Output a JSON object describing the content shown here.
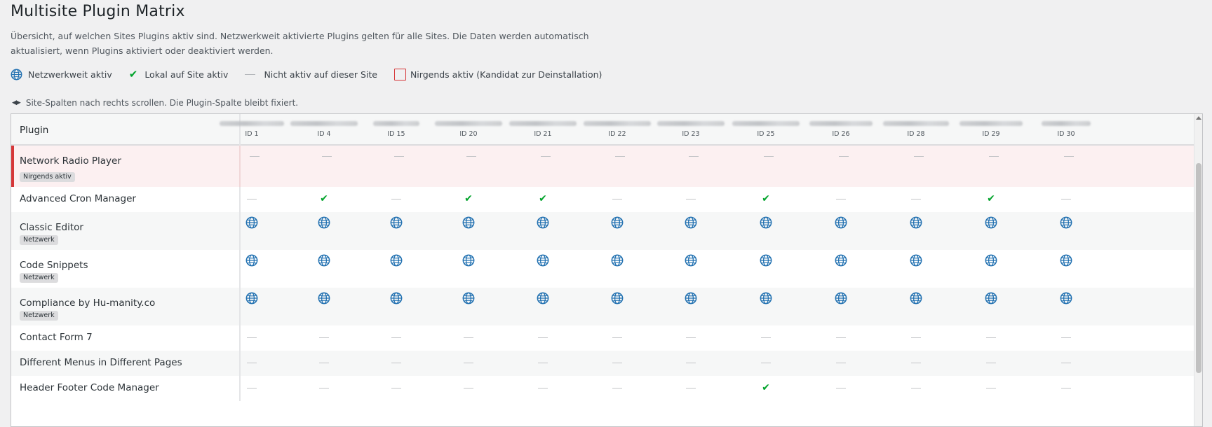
{
  "page": {
    "title": "Multisite Plugin Matrix",
    "description": "Übersicht, auf welchen Sites Plugins aktiv sind. Netzwerkweit aktivierte Plugins gelten für alle Sites. Die Daten werden automatisch aktualisiert, wenn Plugins aktiviert oder deaktiviert werden."
  },
  "legend": {
    "network": "Netzwerkweit aktiv",
    "local": "Lokal auf Site aktiv",
    "inactive": "Nicht aktiv auf dieser Site",
    "nowhere": "Nirgends aktiv (Kandidat zur Deinstallation)"
  },
  "scroll_hint": "Site-Spalten nach rechts scrollen. Die Plugin-Spalte bleibt fixiert.",
  "table": {
    "plugin_header": "Plugin",
    "sites": [
      "ID 1",
      "ID 4",
      "ID 15",
      "ID 20",
      "ID 21",
      "ID 22",
      "ID 23",
      "ID 25",
      "ID 26",
      "ID 28",
      "ID 29",
      "ID 30"
    ],
    "rows": [
      {
        "name": "Network Radio Player",
        "badge": "Nirgends aktiv",
        "variant": "danger",
        "cells": [
          "none",
          "none",
          "none",
          "none",
          "none",
          "none",
          "none",
          "none",
          "none",
          "none",
          "none",
          "none"
        ]
      },
      {
        "name": "Advanced Cron Manager",
        "badge": "",
        "variant": "white",
        "cells": [
          "none",
          "local",
          "none",
          "local",
          "local",
          "none",
          "none",
          "local",
          "none",
          "none",
          "local",
          "none"
        ]
      },
      {
        "name": "Classic Editor",
        "badge": "Netzwerk",
        "variant": "alt",
        "cells": [
          "network",
          "network",
          "network",
          "network",
          "network",
          "network",
          "network",
          "network",
          "network",
          "network",
          "network",
          "network"
        ]
      },
      {
        "name": "Code Snippets",
        "badge": "Netzwerk",
        "variant": "white",
        "cells": [
          "network",
          "network",
          "network",
          "network",
          "network",
          "network",
          "network",
          "network",
          "network",
          "network",
          "network",
          "network"
        ]
      },
      {
        "name": "Compliance by Hu-manity.co",
        "badge": "Netzwerk",
        "variant": "alt",
        "cells": [
          "network",
          "network",
          "network",
          "network",
          "network",
          "network",
          "network",
          "network",
          "network",
          "network",
          "network",
          "network"
        ]
      },
      {
        "name": "Contact Form 7",
        "badge": "",
        "variant": "white",
        "cells": [
          "none",
          "none",
          "none",
          "none",
          "none",
          "none",
          "none",
          "none",
          "none",
          "none",
          "none",
          "none"
        ]
      },
      {
        "name": "Different Menus in Different Pages",
        "badge": "",
        "variant": "alt",
        "cells": [
          "none",
          "none",
          "none",
          "none",
          "none",
          "none",
          "none",
          "none",
          "none",
          "none",
          "none",
          "none"
        ]
      },
      {
        "name": "Header Footer Code Manager",
        "badge": "",
        "variant": "white",
        "cells": [
          "none",
          "none",
          "none",
          "none",
          "none",
          "none",
          "none",
          "local",
          "none",
          "none",
          "none",
          "none"
        ]
      }
    ]
  },
  "colors": {
    "accent_blue": "#2271b1",
    "check_green": "#00a32a",
    "danger_red": "#d63638"
  },
  "icons": {
    "network": "globe-icon",
    "local": "checkmark-icon",
    "inactive": "dash-icon",
    "nowhere": "red-square-icon",
    "scroll": "left-right-arrows-icon"
  }
}
